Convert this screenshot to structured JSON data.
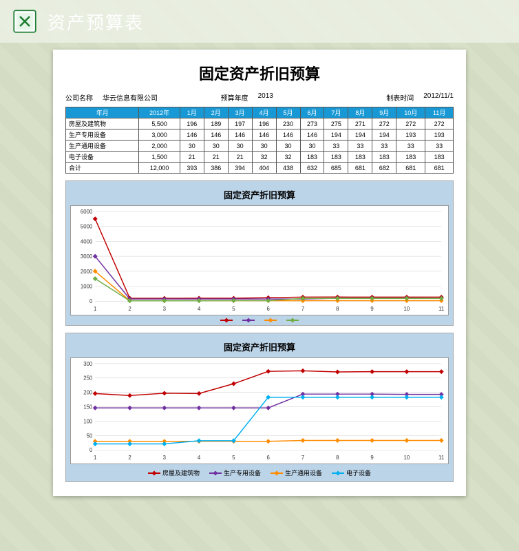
{
  "header": {
    "title": "资产预算表"
  },
  "doc": {
    "title": "固定资产折旧预算",
    "meta": {
      "company_label": "公司名称",
      "company_value": "华云信息有限公司",
      "year_label": "预算年度",
      "year_value": "2013",
      "date_label": "制表时间",
      "date_value": "2012/11/1"
    },
    "table": {
      "headers": [
        "年月",
        "2012年",
        "1月",
        "2月",
        "3月",
        "4月",
        "5月",
        "6月",
        "7月",
        "8月",
        "9月",
        "10月",
        "11月"
      ],
      "rows": [
        [
          "房屋及建筑物",
          "5,500",
          "196",
          "189",
          "197",
          "196",
          "230",
          "273",
          "275",
          "271",
          "272",
          "272",
          "272"
        ],
        [
          "生产专用设备",
          "3,000",
          "146",
          "146",
          "146",
          "146",
          "146",
          "146",
          "194",
          "194",
          "194",
          "193",
          "193"
        ],
        [
          "生产通用设备",
          "2,000",
          "30",
          "30",
          "30",
          "30",
          "30",
          "30",
          "33",
          "33",
          "33",
          "33",
          "33"
        ],
        [
          "电子设备",
          "1,500",
          "21",
          "21",
          "21",
          "32",
          "32",
          "183",
          "183",
          "183",
          "183",
          "183",
          "183"
        ],
        [
          "合计",
          "12,000",
          "393",
          "386",
          "394",
          "404",
          "438",
          "632",
          "685",
          "681",
          "682",
          "681",
          "681"
        ]
      ]
    }
  },
  "chart_data": [
    {
      "type": "line",
      "title": "固定资产折旧预算",
      "xlabel": "",
      "ylabel": "",
      "x": [
        1,
        2,
        3,
        4,
        5,
        6,
        7,
        8,
        9,
        10,
        11
      ],
      "ylim": [
        0,
        6000
      ],
      "series": [
        {
          "name": "房屋及建筑物",
          "color": "#c00000",
          "values": [
            5500,
            196,
            189,
            197,
            196,
            230,
            273,
            275,
            271,
            272,
            272
          ]
        },
        {
          "name": "生产专用设备",
          "color": "#7030a0",
          "values": [
            3000,
            146,
            146,
            146,
            146,
            146,
            146,
            194,
            194,
            194,
            193
          ]
        },
        {
          "name": "生产通用设备",
          "color": "#ff8c00",
          "values": [
            2000,
            30,
            30,
            30,
            30,
            30,
            30,
            33,
            33,
            33,
            33
          ]
        },
        {
          "name": "电子设备",
          "color": "#70ad47",
          "values": [
            1500,
            21,
            21,
            21,
            32,
            32,
            183,
            183,
            183,
            183,
            183
          ]
        }
      ]
    },
    {
      "type": "line",
      "title": "固定资产折旧预算",
      "xlabel": "",
      "ylabel": "",
      "x": [
        1,
        2,
        3,
        4,
        5,
        6,
        7,
        8,
        9,
        10,
        11
      ],
      "ylim": [
        0,
        300
      ],
      "series": [
        {
          "name": "房屋及建筑物",
          "color": "#c00000",
          "values": [
            196,
            189,
            197,
            196,
            230,
            273,
            275,
            271,
            272,
            272,
            272
          ]
        },
        {
          "name": "生产专用设备",
          "color": "#7030a0",
          "values": [
            146,
            146,
            146,
            146,
            146,
            146,
            194,
            194,
            194,
            193,
            193
          ]
        },
        {
          "name": "生产通用设备",
          "color": "#ff8c00",
          "values": [
            30,
            30,
            30,
            30,
            30,
            30,
            33,
            33,
            33,
            33,
            33
          ]
        },
        {
          "name": "电子设备",
          "color": "#00b0f0",
          "values": [
            21,
            21,
            21,
            32,
            32,
            183,
            183,
            183,
            183,
            183,
            183
          ]
        }
      ]
    }
  ]
}
